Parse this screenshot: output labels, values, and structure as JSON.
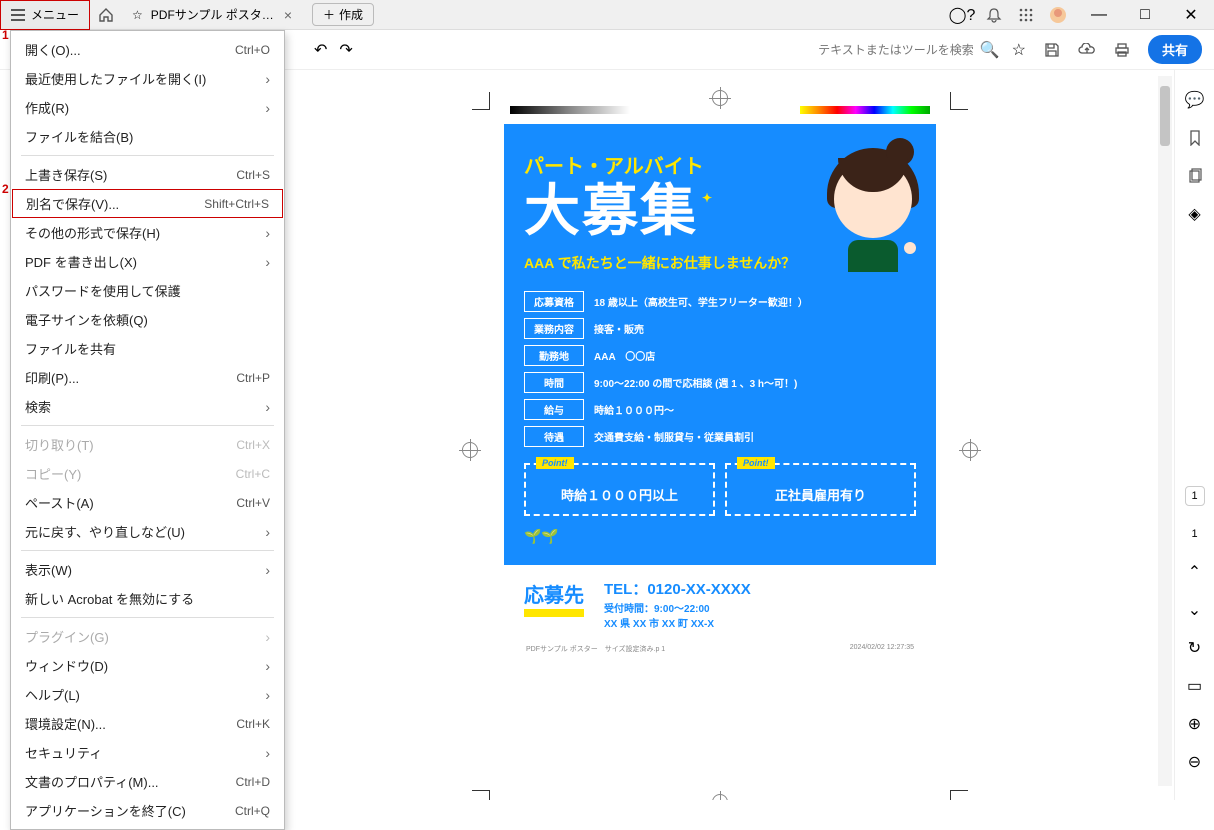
{
  "titlebar": {
    "menu_label": "メニュー",
    "tab_title": "PDFサンプル ポスター ...",
    "create_label": "作成"
  },
  "annotations": {
    "a1": "1",
    "a2": "2"
  },
  "menu": {
    "open": "開く(O)...",
    "open_sc": "Ctrl+O",
    "recent": "最近使用したファイルを開く(I)",
    "create": "作成(R)",
    "combine": "ファイルを結合(B)",
    "save": "上書き保存(S)",
    "save_sc": "Ctrl+S",
    "saveas": "別名で保存(V)...",
    "saveas_sc": "Shift+Ctrl+S",
    "saveother": "その他の形式で保存(H)",
    "export": "PDF を書き出し(X)",
    "protect": "パスワードを使用して保護",
    "esign": "電子サインを依頼(Q)",
    "share": "ファイルを共有",
    "print": "印刷(P)...",
    "print_sc": "Ctrl+P",
    "search": "検索",
    "cut": "切り取り(T)",
    "cut_sc": "Ctrl+X",
    "copy": "コピー(Y)",
    "copy_sc": "Ctrl+C",
    "paste": "ペースト(A)",
    "paste_sc": "Ctrl+V",
    "undo": "元に戻す、やり直しなど(U)",
    "view": "表示(W)",
    "disable": "新しい Acrobat を無効にする",
    "plugin": "プラグイン(G)",
    "window": "ウィンドウ(D)",
    "help": "ヘルプ(L)",
    "prefs": "環境設定(N)...",
    "prefs_sc": "Ctrl+K",
    "security": "セキュリティ",
    "props": "文書のプロパティ(M)...",
    "props_sc": "Ctrl+D",
    "quit": "アプリケーションを終了(C)",
    "quit_sc": "Ctrl+Q"
  },
  "toolbar": {
    "search_placeholder": "テキストまたはツールを検索",
    "share_label": "共有"
  },
  "right_rail": {
    "page_current": "1",
    "page_total": "1"
  },
  "poster": {
    "sub": "パート・アルバイト",
    "title": "大募集",
    "ask": "AAA で私たちと一緒にお仕事しませんか？",
    "rows": [
      {
        "label": "応募資格",
        "val": "18 歳以上（高校生可、学生フリーター歓迎！）"
      },
      {
        "label": "業務内容",
        "val": "接客・販売"
      },
      {
        "label": "勤務地",
        "val": "AAA　〇〇店"
      },
      {
        "label": "時間",
        "val": "9:00〜22:00 の間で応相談 (週 1 、3 h〜可！)"
      },
      {
        "label": "給与",
        "val": "時給１０００円〜"
      },
      {
        "label": "待遇",
        "val": "交通費支給・制服貸与・従業員割引"
      }
    ],
    "point_tag": "Point!",
    "point1": "時給１０００円以上",
    "point2": "正社員雇用有り",
    "apply_label": "応募先",
    "tel": "TEL：0120-XX-XXXX",
    "hours": "受付時間：9:00〜22:00",
    "addr": "XX 県 XX 市 XX 町 XX-X",
    "footer_l": "PDFサンプル ポスター　サイズ設定済み.p    1",
    "footer_r": "2024/02/02   12:27:35"
  }
}
